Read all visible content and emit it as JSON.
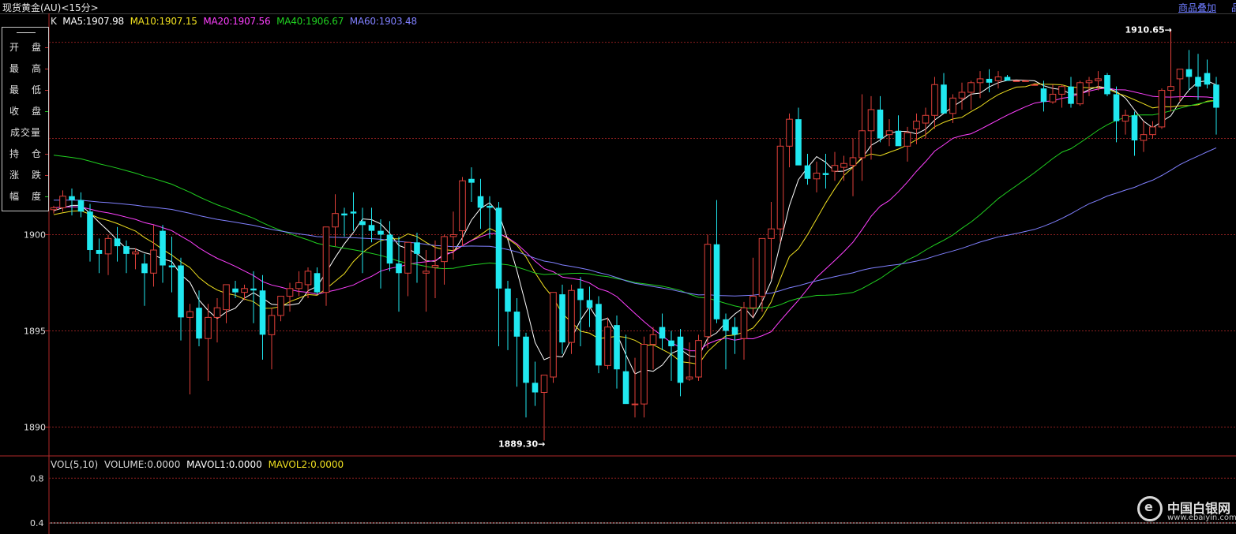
{
  "header": {
    "title": "现货黄金(AU)<15分>",
    "overlay_link": "商品叠加",
    "edge_mark": "品"
  },
  "ma_legend": {
    "k_label": "K",
    "items": [
      {
        "text": "MA5:1907.98",
        "color": "#ffffff"
      },
      {
        "text": "MA10:1907.15",
        "color": "#f0e020"
      },
      {
        "text": "MA20:1907.56",
        "color": "#ff40ff"
      },
      {
        "text": "MA40:1906.67",
        "color": "#20d020"
      },
      {
        "text": "MA60:1903.48",
        "color": "#8080ff"
      }
    ]
  },
  "info_panel": {
    "rows": [
      "开盘",
      "最高",
      "最低",
      "收盘",
      "成交量",
      "持仓",
      "涨跌",
      "幅度"
    ]
  },
  "vol_legend": {
    "items": [
      {
        "text": "VOL(5,10)",
        "color": "#d8d8d8"
      },
      {
        "text": "VOLUME:0.0000",
        "color": "#d8d8d8"
      },
      {
        "text": "MAVOL1:0.0000",
        "color": "#ffffff"
      },
      {
        "text": "MAVOL2:0.0000",
        "color": "#f0e020"
      }
    ]
  },
  "watermark": {
    "name": "中国白银网",
    "url": "www.ebaiyin.com"
  },
  "colors": {
    "up": "#e0403a",
    "down": "#20e8f0",
    "grid": "#8a1f1f",
    "axis": "#b02828"
  },
  "chart_data": {
    "type": "candlestick",
    "title": "现货黄金(AU)<15分>",
    "price_axis": {
      "ticks": [
        1890,
        1895,
        1900
      ],
      "ylim": [
        1888.5,
        1911.5
      ]
    },
    "volume_axis": {
      "ticks": [
        0.4,
        0.8
      ],
      "ylim": [
        0.3,
        1.0
      ]
    },
    "annotations": [
      {
        "text": "1910.65→",
        "price": 1910.65,
        "type": "high"
      },
      {
        "text": "1889.30→",
        "price": 1889.3,
        "type": "low"
      }
    ],
    "candles": [
      [
        1901.3,
        1901.5,
        1901.1,
        1901.4
      ],
      [
        1901.4,
        1902.3,
        1901.2,
        1902.0
      ],
      [
        1902.0,
        1902.4,
        1901.0,
        1901.8
      ],
      [
        1901.8,
        1902.2,
        1900.9,
        1901.2
      ],
      [
        1901.2,
        1901.6,
        1898.6,
        1899.2
      ],
      [
        1899.2,
        1899.8,
        1898.0,
        1899.0
      ],
      [
        1899.0,
        1900.0,
        1897.9,
        1899.8
      ],
      [
        1899.8,
        1900.4,
        1898.6,
        1899.4
      ],
      [
        1899.4,
        1899.7,
        1898.0,
        1899.0
      ],
      [
        1899.0,
        1899.3,
        1898.2,
        1899.1
      ],
      [
        1898.5,
        1899.0,
        1896.3,
        1898.0
      ],
      [
        1898.0,
        1900.5,
        1897.3,
        1899.2
      ],
      [
        1900.2,
        1900.5,
        1897.5,
        1898.4
      ],
      [
        1898.4,
        1899.9,
        1897.0,
        1898.3
      ],
      [
        1898.4,
        1898.8,
        1894.5,
        1895.7
      ],
      [
        1895.7,
        1896.4,
        1891.7,
        1896.0
      ],
      [
        1896.2,
        1897.1,
        1894.2,
        1894.6
      ],
      [
        1894.6,
        1896.4,
        1892.4,
        1895.7
      ],
      [
        1895.7,
        1896.7,
        1894.4,
        1896.2
      ],
      [
        1896.1,
        1897.2,
        1895.4,
        1897.4
      ],
      [
        1897.2,
        1897.6,
        1896.7,
        1897.0
      ],
      [
        1897.0,
        1897.4,
        1896.6,
        1897.2
      ],
      [
        1897.2,
        1898.1,
        1895.4,
        1897.1
      ],
      [
        1897.1,
        1897.9,
        1893.5,
        1894.8
      ],
      [
        1894.8,
        1896.2,
        1893.0,
        1895.8
      ],
      [
        1895.8,
        1896.8,
        1895.5,
        1896.8
      ],
      [
        1896.8,
        1897.5,
        1896.0,
        1897.2
      ],
      [
        1897.2,
        1898.1,
        1896.8,
        1897.5
      ],
      [
        1897.4,
        1898.3,
        1896.7,
        1898.1
      ],
      [
        1898.0,
        1898.3,
        1896.9,
        1897.0
      ],
      [
        1897.0,
        1900.4,
        1896.3,
        1900.4
      ],
      [
        1900.4,
        1902.1,
        1899.4,
        1901.1
      ],
      [
        1901.1,
        1901.4,
        1899.9,
        1901.0
      ],
      [
        1901.2,
        1902.2,
        1900.2,
        1901.1
      ],
      [
        1900.7,
        1901.4,
        1898.0,
        1900.5
      ],
      [
        1900.5,
        1901.4,
        1899.6,
        1900.2
      ],
      [
        1900.2,
        1900.8,
        1897.2,
        1900.0
      ],
      [
        1900.0,
        1900.7,
        1898.1,
        1898.5
      ],
      [
        1898.5,
        1899.9,
        1896.0,
        1898.0
      ],
      [
        1898.0,
        1899.6,
        1896.8,
        1899.6
      ],
      [
        1899.6,
        1900.1,
        1897.5,
        1899.0
      ],
      [
        1898.0,
        1899.2,
        1896.0,
        1898.1
      ],
      [
        1898.3,
        1899.7,
        1896.7,
        1898.4
      ],
      [
        1898.6,
        1900.0,
        1897.4,
        1899.9
      ],
      [
        1899.9,
        1901.2,
        1898.7,
        1900.0
      ],
      [
        1900.2,
        1903.0,
        1899.4,
        1902.8
      ],
      [
        1902.9,
        1903.5,
        1901.7,
        1902.7
      ],
      [
        1902.0,
        1902.9,
        1900.3,
        1901.4
      ],
      [
        1901.5,
        1902.0,
        1899.8,
        1901.4
      ],
      [
        1901.4,
        1901.7,
        1894.2,
        1897.2
      ],
      [
        1897.2,
        1897.6,
        1894.0,
        1896.0
      ],
      [
        1896.0,
        1896.7,
        1892.1,
        1894.7
      ],
      [
        1894.7,
        1894.9,
        1890.5,
        1892.3
      ],
      [
        1892.3,
        1893.4,
        1891.1,
        1891.8
      ],
      [
        1891.8,
        1892.6,
        1889.3,
        1892.7
      ],
      [
        1892.6,
        1896.8,
        1892.3,
        1897.0
      ],
      [
        1896.9,
        1897.4,
        1893.8,
        1894.4
      ],
      [
        1894.4,
        1897.4,
        1893.8,
        1897.1
      ],
      [
        1897.2,
        1897.8,
        1894.2,
        1896.6
      ],
      [
        1896.6,
        1897.3,
        1895.2,
        1896.2
      ],
      [
        1896.4,
        1896.8,
        1892.8,
        1893.2
      ],
      [
        1893.2,
        1895.7,
        1893.0,
        1895.2
      ],
      [
        1895.3,
        1895.8,
        1892.0,
        1893.0
      ],
      [
        1892.9,
        1894.8,
        1891.5,
        1891.2
      ],
      [
        1891.2,
        1893.6,
        1890.5,
        1891.2
      ],
      [
        1891.2,
        1894.7,
        1890.5,
        1894.3
      ],
      [
        1894.3,
        1895.2,
        1893.0,
        1894.8
      ],
      [
        1895.2,
        1895.9,
        1894.0,
        1894.6
      ],
      [
        1894.5,
        1895.0,
        1892.4,
        1894.2
      ],
      [
        1894.7,
        1895.1,
        1891.6,
        1892.3
      ],
      [
        1892.5,
        1894.4,
        1892.4,
        1892.6
      ],
      [
        1892.6,
        1894.8,
        1892.4,
        1894.5
      ],
      [
        1894.7,
        1900.0,
        1894.1,
        1899.5
      ],
      [
        1899.5,
        1901.8,
        1895.4,
        1895.6
      ],
      [
        1895.6,
        1895.9,
        1893.0,
        1895.0
      ],
      [
        1895.2,
        1895.7,
        1893.8,
        1894.8
      ],
      [
        1894.6,
        1896.5,
        1893.5,
        1896.2
      ],
      [
        1896.2,
        1898.8,
        1895.7,
        1896.8
      ],
      [
        1896.8,
        1899.6,
        1896.0,
        1899.8
      ],
      [
        1899.8,
        1901.7,
        1897.7,
        1900.3
      ],
      [
        1900.3,
        1905.0,
        1899.6,
        1904.6
      ],
      [
        1904.6,
        1906.3,
        1903.5,
        1906.0
      ],
      [
        1906.0,
        1906.6,
        1904.2,
        1903.6
      ],
      [
        1903.6,
        1904.2,
        1902.6,
        1902.9
      ],
      [
        1902.9,
        1903.8,
        1902.2,
        1903.2
      ],
      [
        1903.2,
        1904.2,
        1902.4,
        1903.1
      ],
      [
        1903.3,
        1904.3,
        1902.8,
        1903.6
      ],
      [
        1903.5,
        1904.1,
        1902.8,
        1903.7
      ],
      [
        1903.6,
        1905.0,
        1902.0,
        1904.0
      ],
      [
        1904.0,
        1907.3,
        1902.8,
        1905.4
      ],
      [
        1905.4,
        1907.2,
        1903.9,
        1906.5
      ],
      [
        1906.5,
        1907.2,
        1904.8,
        1905.0
      ],
      [
        1905.2,
        1906.0,
        1904.6,
        1905.4
      ],
      [
        1905.4,
        1906.2,
        1904.8,
        1904.6
      ],
      [
        1904.6,
        1905.6,
        1903.8,
        1905.3
      ],
      [
        1905.5,
        1906.3,
        1904.7,
        1905.9
      ],
      [
        1905.8,
        1906.6,
        1905.0,
        1906.2
      ],
      [
        1906.2,
        1908.2,
        1905.5,
        1907.8
      ],
      [
        1907.8,
        1908.4,
        1906.5,
        1906.3
      ],
      [
        1906.3,
        1907.3,
        1905.8,
        1907.1
      ],
      [
        1907.1,
        1907.9,
        1906.5,
        1907.4
      ],
      [
        1907.4,
        1908.0,
        1906.5,
        1907.9
      ],
      [
        1907.9,
        1908.5,
        1907.1,
        1908.1
      ],
      [
        1908.1,
        1908.6,
        1907.4,
        1907.9
      ],
      [
        1908.0,
        1908.5,
        1907.6,
        1908.2
      ],
      [
        1908.2,
        1908.3,
        1908.0,
        1908.0
      ],
      [
        1908.0,
        1908.0,
        1908.0,
        1908.0
      ],
      [
        1908.0,
        1908.0,
        1908.0,
        1908.0
      ],
      [
        1907.8,
        1907.8,
        1907.8,
        1907.8
      ],
      [
        1907.6,
        1908.0,
        1906.4,
        1906.9
      ],
      [
        1906.9,
        1907.8,
        1906.8,
        1907.3
      ],
      [
        1907.3,
        1907.8,
        1906.6,
        1907.7
      ],
      [
        1907.7,
        1908.2,
        1906.6,
        1906.8
      ],
      [
        1906.8,
        1908.0,
        1906.7,
        1907.9
      ],
      [
        1907.9,
        1908.2,
        1907.2,
        1908.0
      ],
      [
        1908.0,
        1908.5,
        1907.5,
        1908.1
      ],
      [
        1908.3,
        1908.4,
        1907.2,
        1907.3
      ],
      [
        1907.3,
        1907.7,
        1904.8,
        1905.9
      ],
      [
        1905.9,
        1906.5,
        1905.2,
        1906.2
      ],
      [
        1906.2,
        1906.4,
        1904.1,
        1904.9
      ],
      [
        1904.9,
        1905.9,
        1904.3,
        1905.2
      ],
      [
        1905.2,
        1905.9,
        1905.0,
        1905.6
      ],
      [
        1905.6,
        1907.6,
        1905.5,
        1907.5
      ],
      [
        1907.5,
        1910.6,
        1906.4,
        1907.7
      ],
      [
        1908.1,
        1908.6,
        1906.9,
        1908.6
      ],
      [
        1908.6,
        1909.6,
        1907.5,
        1908.2
      ],
      [
        1908.2,
        1909.4,
        1907.0,
        1907.7
      ],
      [
        1908.4,
        1909.1,
        1907.6,
        1907.8
      ],
      [
        1907.8,
        1908.2,
        1905.2,
        1906.6
      ]
    ]
  }
}
